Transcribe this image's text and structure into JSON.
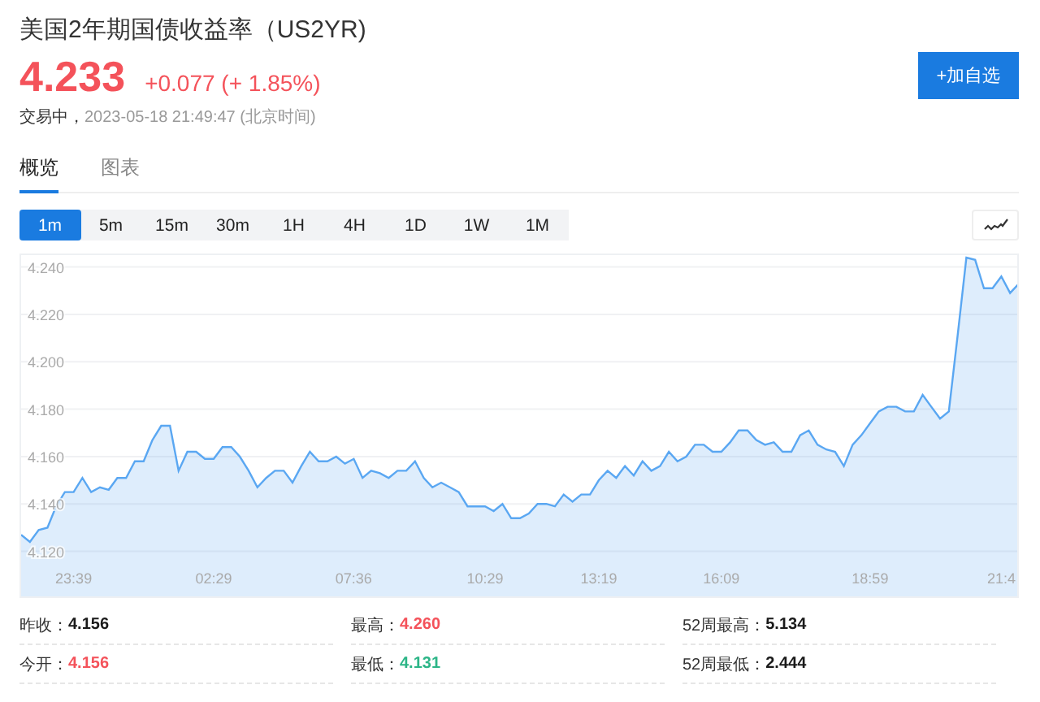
{
  "header": {
    "title": "美国2年期国债收益率（US2YR)",
    "price": "4.233",
    "change": "+0.077 (+ 1.85%)",
    "color": "#f4525a",
    "status": "交易中，",
    "time": "2023-05-18 21:49:47 (北京时间)",
    "add_button": "+加自选"
  },
  "tabs": [
    {
      "label": "概览",
      "selected": true
    },
    {
      "label": "图表",
      "selected": false
    }
  ],
  "periods": [
    {
      "label": "1m",
      "selected": true
    },
    {
      "label": "5m",
      "selected": false
    },
    {
      "label": "15m",
      "selected": false
    },
    {
      "label": "30m",
      "selected": false
    },
    {
      "label": "1H",
      "selected": false
    },
    {
      "label": "4H",
      "selected": false
    },
    {
      "label": "1D",
      "selected": false
    },
    {
      "label": "1W",
      "selected": false
    },
    {
      "label": "1M",
      "selected": false
    }
  ],
  "chart": {
    "chart_data": {
      "type": "area",
      "categories": [
        null,
        null,
        null,
        null,
        null,
        null,
        "23:39",
        null,
        null,
        null,
        null,
        null,
        null,
        null,
        null,
        null,
        null,
        null,
        null,
        null,
        null,
        null,
        "02:29",
        null,
        null,
        null,
        null,
        null,
        null,
        null,
        null,
        null,
        null,
        null,
        null,
        null,
        null,
        null,
        "07:36",
        null,
        null,
        null,
        null,
        null,
        null,
        null,
        null,
        null,
        null,
        null,
        null,
        null,
        null,
        "10:29",
        null,
        null,
        null,
        null,
        null,
        null,
        null,
        null,
        null,
        null,
        null,
        null,
        "13:19",
        null,
        null,
        null,
        null,
        null,
        null,
        null,
        null,
        null,
        null,
        null,
        null,
        null,
        "16:09",
        null,
        null,
        null,
        null,
        null,
        null,
        null,
        null,
        null,
        null,
        null,
        null,
        null,
        null,
        null,
        null,
        "18:59",
        null,
        null,
        null,
        null,
        null,
        null,
        null,
        null,
        null,
        null,
        null,
        null,
        null,
        null,
        "21:4",
        null,
        null
      ],
      "series": [
        {
          "color": "#5aa7f2",
          "values": [
            4.127,
            4.124,
            4.129,
            4.13,
            4.139,
            4.145,
            4.145,
            4.151,
            4.145,
            4.147,
            4.146,
            4.151,
            4.151,
            4.158,
            4.158,
            4.167,
            4.173,
            4.173,
            4.154,
            4.162,
            4.162,
            4.159,
            4.159,
            4.164,
            4.164,
            4.16,
            4.154,
            4.147,
            4.151,
            4.154,
            4.154,
            4.149,
            4.156,
            4.162,
            4.158,
            4.158,
            4.16,
            4.157,
            4.159,
            4.151,
            4.154,
            4.153,
            4.151,
            4.154,
            4.154,
            4.158,
            4.151,
            4.147,
            4.149,
            4.147,
            4.145,
            4.139,
            4.139,
            4.139,
            4.137,
            4.14,
            4.134,
            4.134,
            4.136,
            4.14,
            4.14,
            4.139,
            4.144,
            4.141,
            4.144,
            4.144,
            4.15,
            4.154,
            4.151,
            4.156,
            4.152,
            4.158,
            4.154,
            4.156,
            4.162,
            4.158,
            4.16,
            4.165,
            4.165,
            4.162,
            4.162,
            4.166,
            4.171,
            4.171,
            4.167,
            4.165,
            4.166,
            4.162,
            4.162,
            4.169,
            4.171,
            4.165,
            4.163,
            4.162,
            4.156,
            4.165,
            4.169,
            4.174,
            4.179,
            4.181,
            4.181,
            4.179,
            4.179,
            4.186,
            4.181,
            4.176,
            4.179,
            4.211,
            4.244,
            4.243,
            4.231,
            4.231,
            4.236,
            4.229,
            4.233
          ]
        }
      ],
      "ylim": [
        4.101,
        4.245
      ],
      "grid": true,
      "yticks": [
        {
          "value": 4.12,
          "label": "4.120"
        },
        {
          "value": 4.14,
          "label": "4.140"
        },
        {
          "value": 4.16,
          "label": "4.160"
        },
        {
          "value": 4.18,
          "label": "4.180"
        },
        {
          "value": 4.2,
          "label": "4.200"
        },
        {
          "value": 4.22,
          "label": "4.220"
        },
        {
          "value": 4.24,
          "label": "4.240"
        }
      ]
    }
  },
  "stats": [
    {
      "label": "昨收：",
      "value": "4.156",
      "color": "#1a1a1a"
    },
    {
      "label": "最高：",
      "value": "4.260",
      "color": "#f4525a"
    },
    {
      "label": "52周最高：",
      "value": "5.134",
      "color": "#1a1a1a"
    },
    {
      "label": "今开：",
      "value": "4.156",
      "color": "#f4525a"
    },
    {
      "label": "最低：",
      "value": "4.131",
      "color": "#2cb587"
    },
    {
      "label": "52周最低：",
      "value": "2.444",
      "color": "#1a1a1a"
    }
  ]
}
